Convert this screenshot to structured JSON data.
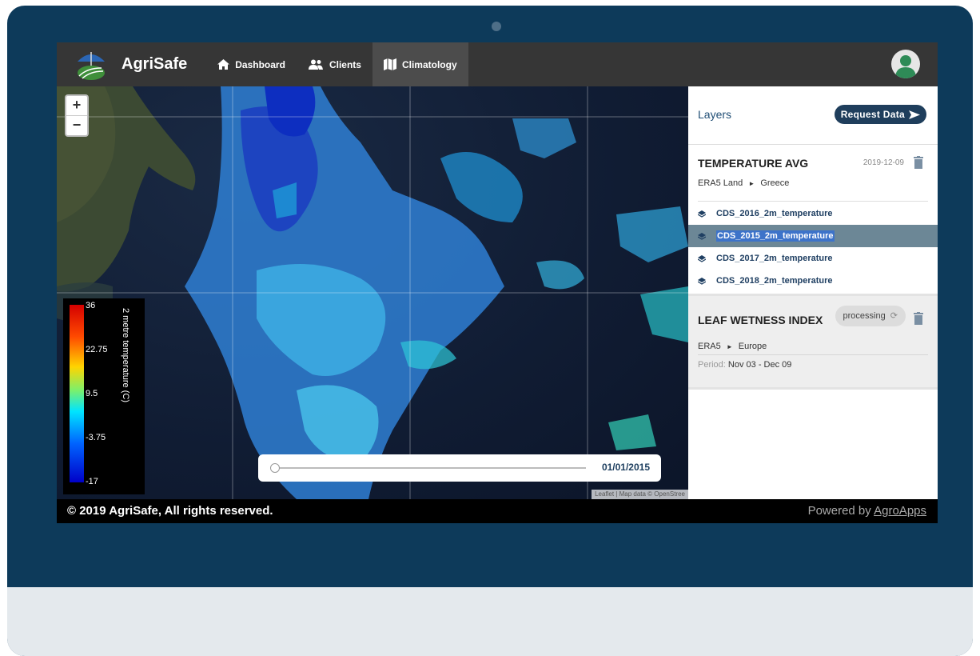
{
  "brand": {
    "name": "AgriSafe"
  },
  "nav": {
    "items": [
      {
        "label": "Dashboard",
        "icon": "home-icon"
      },
      {
        "label": "Clients",
        "icon": "users-icon"
      },
      {
        "label": "Climatology",
        "icon": "map-icon",
        "active": true
      }
    ]
  },
  "map": {
    "zoom_in": "+",
    "zoom_out": "−",
    "legend": {
      "title": "2 metre temperature (C)",
      "ticks": [
        "36",
        "22.75",
        "9.5",
        "-3.75",
        "-17"
      ]
    },
    "timeline": {
      "date": "01/01/2015"
    },
    "attribution": "Leaflet | Map data © OpenStree"
  },
  "panel": {
    "title": "Layers",
    "request_button": "Request Data",
    "layers": [
      {
        "title": "TEMPERATURE AVG",
        "date": "2019-12-09",
        "source": "ERA5 Land",
        "region": "Greece",
        "items": [
          "CDS_2016_2m_temperature",
          "CDS_2015_2m_temperature",
          "CDS_2017_2m_temperature",
          "CDS_2018_2m_temperature"
        ],
        "selected_index": 1
      },
      {
        "title": "LEAF WETNESS INDEX",
        "status": "processing",
        "source": "ERA5",
        "region": "Europe",
        "period_label": "Period:",
        "period_value": "Nov 03 - Dec 09"
      }
    ]
  },
  "footer": {
    "copyright": "© 2019 AgriSafe, All rights reserved.",
    "powered_prefix": "Powered by",
    "powered_link": "AgroApps"
  },
  "colors": {
    "laptop_frame": "#0d3a5a",
    "topbar": "#363636",
    "accent": "#1f3e5c",
    "selected_row": "#6c8796"
  }
}
